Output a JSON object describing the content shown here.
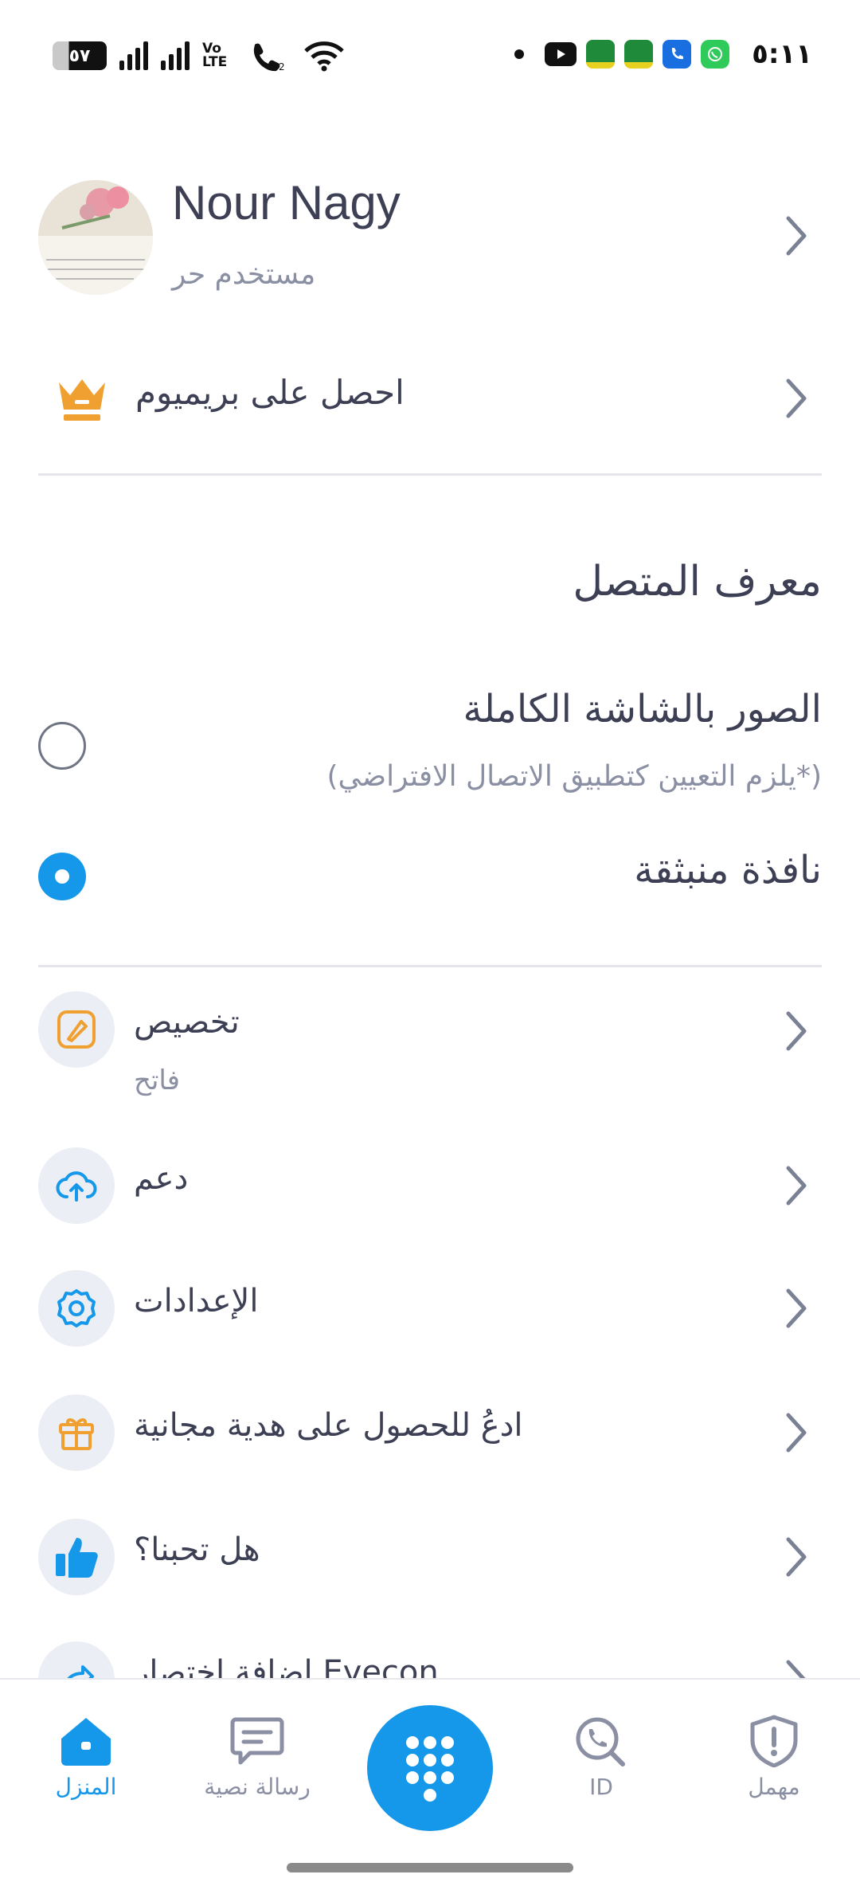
{
  "status_bar": {
    "battery": "٥٧",
    "volte": "Vo LTE",
    "time": "٥:١١",
    "icons": [
      "battery-icon",
      "signal-icon",
      "signal-icon",
      "volte-icon",
      "wifi-call-icon",
      "wifi-icon",
      "youtube-icon",
      "app-icon",
      "app-icon",
      "phone-app-icon",
      "whatsapp-icon"
    ]
  },
  "profile": {
    "name": "Nour Nagy",
    "subtitle": "مستخدم حر"
  },
  "premium": {
    "label": "احصل على بريميوم"
  },
  "caller_id": {
    "title": "معرف المتصل",
    "options": [
      {
        "title": "الصور بالشاشة الكاملة",
        "subtitle": "(*يلزم التعيين كتطبيق الاتصال الافتراضي)",
        "selected": false
      },
      {
        "title": "نافذة منبثقة",
        "selected": true
      }
    ]
  },
  "menu": [
    {
      "label": "تخصيص",
      "sub": "فاتح",
      "icon": "brush-icon"
    },
    {
      "label": "دعم",
      "icon": "cloud-upload-icon"
    },
    {
      "label": "الإعدادات",
      "icon": "gear-icon"
    },
    {
      "label": "ادعُ للحصول على هدية مجانية",
      "icon": "gift-icon"
    },
    {
      "label": "هل تحبنا؟",
      "icon": "thumbs-up-icon"
    },
    {
      "label": "إضافة اختصار Eyecon",
      "icon": "shortcut-icon"
    }
  ],
  "nav": {
    "home": "المنزل",
    "messages": "رسالة نصية",
    "id": "ID",
    "spam": "مهمل"
  },
  "colors": {
    "accent": "#1597ea",
    "orange": "#f0a030",
    "text": "#3d4055",
    "muted": "#8a8fa3"
  }
}
